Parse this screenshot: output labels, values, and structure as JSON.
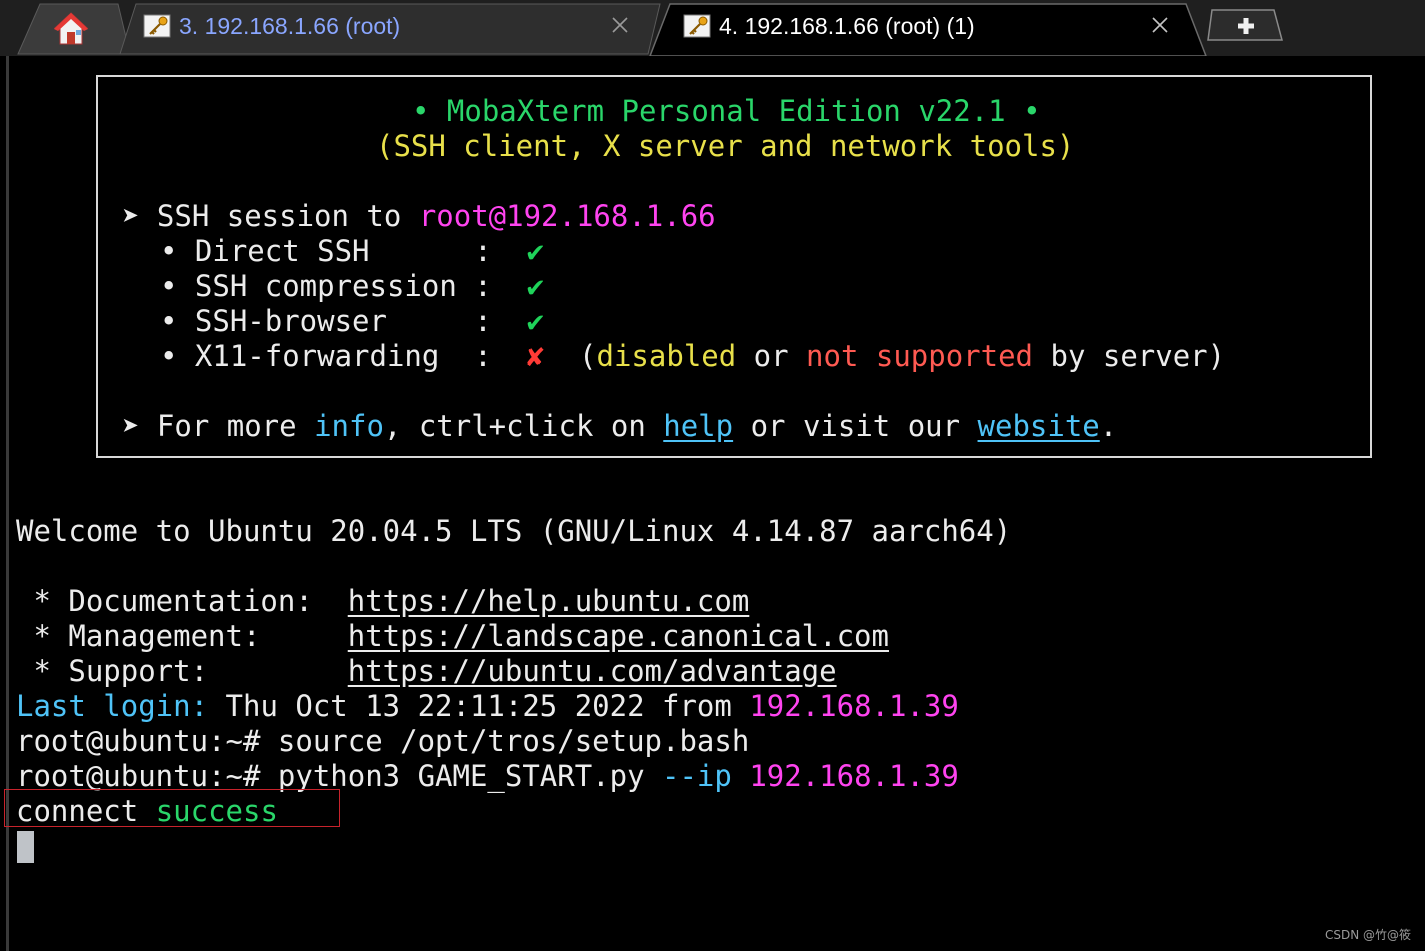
{
  "tabs": [
    {
      "label": "3. 192.168.1.66 (root)",
      "active": false,
      "color": "#8aa6ff"
    },
    {
      "label": "4. 192.168.1.66 (root) (1)",
      "active": true,
      "color": "#ffffff"
    }
  ],
  "icons": {
    "home": "home-icon",
    "session": "key-icon",
    "close": "close-icon",
    "new_tab": "plus-icon"
  },
  "banner": {
    "title": "• MobaXterm Personal Edition v22.1 •",
    "subtitle": "(SSH client, X server and network tools)",
    "session_prefix": "➤ SSH session to ",
    "session_target": "root@192.168.1.66",
    "features": [
      {
        "label": "• Direct SSH      :  ",
        "status": "✔"
      },
      {
        "label": "• SSH compression :  ",
        "status": "✔"
      },
      {
        "label": "• SSH-browser     :  ",
        "status": "✔"
      }
    ],
    "x11": {
      "label": "• X11-forwarding  :  ",
      "status": "✘",
      "open_paren": "  (",
      "disabled": "disabled",
      "or": " or ",
      "not_supported": "not supported",
      "tail": " by server)"
    },
    "more_info": {
      "prefix": "➤ For more ",
      "info": "info",
      "middle": ", ctrl+click on ",
      "help": "help",
      "middle2": " or visit our ",
      "website": "website",
      "end": "."
    }
  },
  "motd": {
    "welcome": "Welcome to Ubuntu 20.04.5 LTS (GNU/Linux 4.14.87 aarch64)",
    "links": [
      {
        "label": " * Documentation:  ",
        "url": "https://help.ubuntu.com"
      },
      {
        "label": " * Management:     ",
        "url": "https://landscape.canonical.com"
      },
      {
        "label": " * Support:        ",
        "url": "https://ubuntu.com/advantage"
      }
    ]
  },
  "last_login": {
    "label": "Last login:",
    "text": " Thu Oct 13 22:11:25 2022 from ",
    "ip": "192.168.1.39"
  },
  "commands": [
    {
      "prompt": "root@ubuntu:~# ",
      "cmd": "source /opt/tros/setup.bash"
    },
    {
      "prompt": "root@ubuntu:~# ",
      "cmd": "python3 GAME_START.py ",
      "flag": "--ip",
      "arg": " 192.168.1.39"
    }
  ],
  "output": {
    "word": "connect ",
    "status": "success"
  },
  "watermark": "CSDN @竹@筱",
  "colors": {
    "background": "#000000",
    "banner_green": "#2ad66a",
    "banner_yellow": "#e8e04a",
    "magenta": "#ff44f0",
    "cyan": "#4fc3f7",
    "red": "#ff5a52",
    "highlight_red": "#c8232c"
  }
}
